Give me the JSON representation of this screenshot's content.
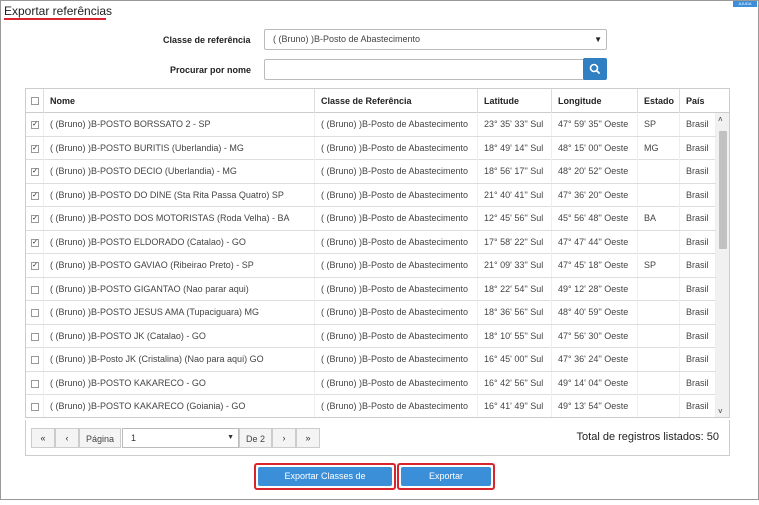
{
  "page": {
    "title": "Exportar referências",
    "corner_tag": "AJUDA"
  },
  "form": {
    "class_label": "Classe de referência",
    "class_value": "( (Bruno) )B-Posto de Abastecimento",
    "search_label": "Procurar por nome",
    "search_value": "",
    "search_placeholder": ""
  },
  "table": {
    "headers": {
      "nome": "Nome",
      "classe": "Classe de Referência",
      "latitude": "Latitude",
      "longitude": "Longitude",
      "estado": "Estado",
      "pais": "País"
    },
    "rows": [
      {
        "checked": true,
        "nome": "( (Bruno) )B-POSTO BORSSATO 2 - SP",
        "classe": "( (Bruno) )B-Posto de Abastecimento",
        "latitude": "23° 35' 33'' Sul",
        "longitude": "47° 59' 35'' Oeste",
        "estado": "SP",
        "pais": "Brasil"
      },
      {
        "checked": true,
        "nome": "( (Bruno) )B-POSTO BURITIS (Uberlandia) - MG",
        "classe": "( (Bruno) )B-Posto de Abastecimento",
        "latitude": "18° 49' 14'' Sul",
        "longitude": "48° 15' 00'' Oeste",
        "estado": "MG",
        "pais": "Brasil"
      },
      {
        "checked": true,
        "nome": "( (Bruno) )B-POSTO DECIO (Uberlandia) - MG",
        "classe": "( (Bruno) )B-Posto de Abastecimento",
        "latitude": "18° 56' 17'' Sul",
        "longitude": "48° 20' 52'' Oeste",
        "estado": "",
        "pais": "Brasil"
      },
      {
        "checked": true,
        "nome": "( (Bruno) )B-POSTO DO DINE (Sta Rita Passa Quatro) SP",
        "classe": "( (Bruno) )B-Posto de Abastecimento",
        "latitude": "21° 40' 41'' Sul",
        "longitude": "47° 36' 20'' Oeste",
        "estado": "",
        "pais": "Brasil"
      },
      {
        "checked": true,
        "nome": "( (Bruno) )B-POSTO DOS MOTORISTAS (Roda Velha) - BA",
        "classe": "( (Bruno) )B-Posto de Abastecimento",
        "latitude": "12° 45' 56'' Sul",
        "longitude": "45° 56' 48'' Oeste",
        "estado": "BA",
        "pais": "Brasil"
      },
      {
        "checked": true,
        "nome": "( (Bruno) )B-POSTO ELDORADO (Catalao) - GO",
        "classe": "( (Bruno) )B-Posto de Abastecimento",
        "latitude": "17° 58' 22'' Sul",
        "longitude": "47° 47' 44'' Oeste",
        "estado": "",
        "pais": "Brasil"
      },
      {
        "checked": true,
        "nome": "( (Bruno) )B-POSTO GAVIAO (Ribeirao Preto) - SP",
        "classe": "( (Bruno) )B-Posto de Abastecimento",
        "latitude": "21° 09' 33'' Sul",
        "longitude": "47° 45' 18'' Oeste",
        "estado": "SP",
        "pais": "Brasil"
      },
      {
        "checked": false,
        "nome": "( (Bruno) )B-POSTO GIGANTAO (Nao parar aqui)",
        "classe": "( (Bruno) )B-Posto de Abastecimento",
        "latitude": "18° 22' 54'' Sul",
        "longitude": "49° 12' 28'' Oeste",
        "estado": "",
        "pais": "Brasil"
      },
      {
        "checked": false,
        "nome": "( (Bruno) )B-POSTO JESUS AMA (Tupaciguara) MG",
        "classe": "( (Bruno) )B-Posto de Abastecimento",
        "latitude": "18° 36' 56'' Sul",
        "longitude": "48° 40' 59'' Oeste",
        "estado": "",
        "pais": "Brasil"
      },
      {
        "checked": false,
        "nome": "( (Bruno) )B-POSTO JK (Catalao) - GO",
        "classe": "( (Bruno) )B-Posto de Abastecimento",
        "latitude": "18° 10' 55'' Sul",
        "longitude": "47° 56' 30'' Oeste",
        "estado": "",
        "pais": "Brasil"
      },
      {
        "checked": false,
        "nome": "( (Bruno) )B-Posto JK (Cristalina) (Nao para aqui) GO",
        "classe": "( (Bruno) )B-Posto de Abastecimento",
        "latitude": "16° 45' 00'' Sul",
        "longitude": "47° 36' 24'' Oeste",
        "estado": "",
        "pais": "Brasil"
      },
      {
        "checked": false,
        "nome": "( (Bruno) )B-POSTO KAKARECO - GO",
        "classe": "( (Bruno) )B-Posto de Abastecimento",
        "latitude": "16° 42' 56'' Sul",
        "longitude": "49° 14' 04'' Oeste",
        "estado": "",
        "pais": "Brasil"
      },
      {
        "checked": false,
        "nome": "( (Bruno) )B-POSTO KAKARECO (Goiania) - GO",
        "classe": "( (Bruno) )B-Posto de Abastecimento",
        "latitude": "16° 41' 49'' Sul",
        "longitude": "49° 13' 54'' Oeste",
        "estado": "",
        "pais": "Brasil"
      }
    ]
  },
  "pager": {
    "page_label": "Página",
    "page_value": "1",
    "of_label": "De 2",
    "total_text": "Total de registros listados: 50"
  },
  "actions": {
    "export_classes_label": "Exportar Classes de referências",
    "export_refs_label": "Exportar Referências"
  }
}
